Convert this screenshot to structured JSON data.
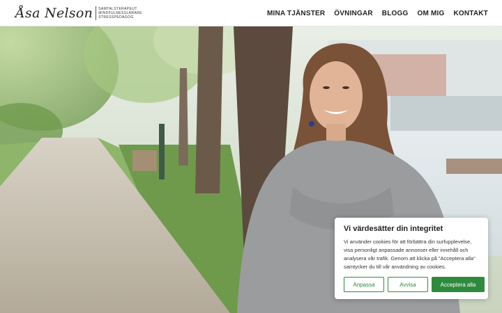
{
  "header": {
    "logo_name": "Åsa Nelson",
    "logo_tags": [
      "SAMTALSTERAPEUT",
      "MINDFULNESSLÄRARE",
      "STRESSPEDAGOG"
    ]
  },
  "nav": {
    "items": [
      {
        "label": "MINA TJÄNSTER"
      },
      {
        "label": "ÖVNINGAR"
      },
      {
        "label": "BLOGG"
      },
      {
        "label": "OM MIG"
      },
      {
        "label": "KONTAKT"
      }
    ]
  },
  "cookie": {
    "title": "Vi värdesätter din integritet",
    "text": "Vi använder cookies för att förbättra din surfupplevelse, visa personligt anpassade annonser eller innehåll och analysera vår trafik. Genom att klicka på \"Acceptera alla\" samtycker du till vår användning av cookies.",
    "customize_label": "Anpassa",
    "reject_label": "Avvisa",
    "accept_label": "Acceptera alla",
    "accent_color": "#2e8b3e"
  }
}
